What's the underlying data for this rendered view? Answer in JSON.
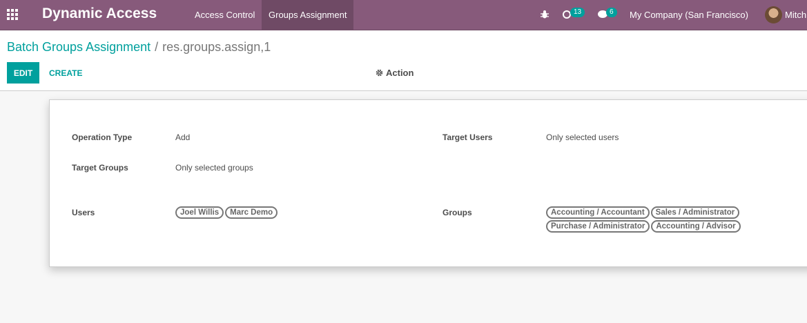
{
  "navbar": {
    "brand": "Dynamic Access",
    "menu": [
      "Access Control",
      "Groups Assignment"
    ],
    "activity_count": "13",
    "message_count": "6",
    "company": "My Company (San Francisco)",
    "user": "Mitch"
  },
  "breadcrumb": {
    "parent": "Batch Groups Assignment",
    "separator": "/",
    "current": "res.groups.assign,1"
  },
  "buttons": {
    "edit": "EDIT",
    "create": "CREATE",
    "action": "Action"
  },
  "form": {
    "operation_type_label": "Operation Type",
    "operation_type_value": "Add",
    "target_users_label": "Target Users",
    "target_users_value": "Only selected users",
    "target_groups_label": "Target Groups",
    "target_groups_value": "Only selected groups",
    "users_label": "Users",
    "users": [
      "Joel Willis",
      "Marc Demo"
    ],
    "groups_label": "Groups",
    "groups": [
      "Accounting / Accountant",
      "Sales / Administrator",
      "Purchase / Administrator",
      "Accounting / Advisor"
    ]
  },
  "colors": {
    "navbar": "#875a7b",
    "accent": "#00a09d"
  }
}
